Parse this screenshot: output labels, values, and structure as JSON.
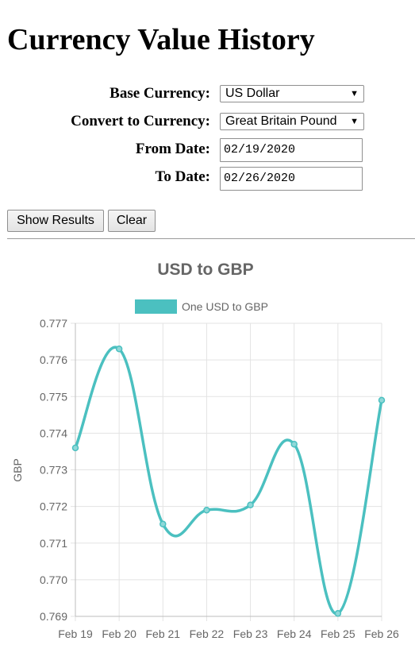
{
  "page": {
    "title": "Currency Value History"
  },
  "form": {
    "base_label": "Base Currency:",
    "base_value": "US Dollar",
    "convert_label": "Convert to Currency:",
    "convert_value": "Great Britain Pound",
    "from_label": "From Date:",
    "from_value": "02/19/2020",
    "to_label": "To Date:",
    "to_value": "02/26/2020",
    "caret_glyph": "▼"
  },
  "buttons": {
    "show_label": "Show Results",
    "clear_label": "Clear"
  },
  "chart_data": {
    "type": "line",
    "title": "USD to GBP",
    "ylabel": "GBP",
    "xlabel": "",
    "categories": [
      "Feb 19",
      "Feb 20",
      "Feb 21",
      "Feb 22",
      "Feb 23",
      "Feb 24",
      "Feb 25",
      "Feb 26"
    ],
    "series": [
      {
        "name": "One USD to GBP",
        "values": [
          0.7736,
          0.7763,
          0.77152,
          0.7719,
          0.77204,
          0.7737,
          0.76908,
          0.7749
        ]
      }
    ],
    "ylim": [
      0.769,
      0.777
    ],
    "yticks": [
      "0.769",
      "0.770",
      "0.771",
      "0.772",
      "0.773",
      "0.774",
      "0.775",
      "0.776",
      "0.777"
    ],
    "grid": true,
    "legend": "top-center",
    "color": "#4bc0c0"
  }
}
